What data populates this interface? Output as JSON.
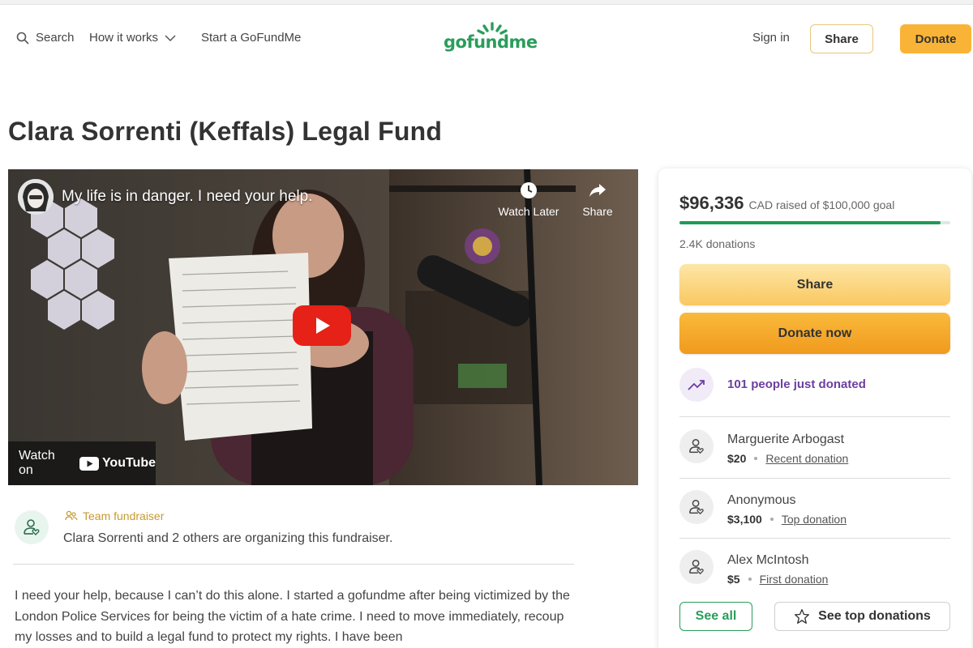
{
  "header": {
    "search_label": "Search",
    "how_label": "How it works",
    "start_label": "Start a GoFundMe",
    "logo_text": "gofundme",
    "signin_label": "Sign in",
    "share_label": "Share",
    "donate_label": "Donate"
  },
  "page": {
    "title": "Clara Sorrenti (Keffals) Legal Fund"
  },
  "video": {
    "title": "My life is in danger. I need your help.",
    "watch_later_label": "Watch Later",
    "share_label": "Share",
    "watch_on_label": "Watch on",
    "youtube_label": "YouTube"
  },
  "organizer": {
    "team_label": "Team fundraiser",
    "text": "Clara Sorrenti and 2 others are organizing this fundraiser."
  },
  "story": {
    "text": "I need your help, because I can’t do this alone. I started a gofundme after being victimized by the London Police Services for being the victim of a hate crime. I need to move immediately, recoup my losses and to build a legal fund to protect my rights. I have been"
  },
  "donation": {
    "amount": "$96,336",
    "goal_text": "CAD raised of $100,000 goal",
    "progress_fraction": 0.96336,
    "count_text": "2.4K donations",
    "share_label": "Share",
    "donate_label": "Donate now",
    "trend_text": "101 people just donated",
    "donors": [
      {
        "name": "Marguerite Arbogast",
        "amount": "$20",
        "tag": "Recent donation"
      },
      {
        "name": "Anonymous",
        "amount": "$3,100",
        "tag": "Top donation"
      },
      {
        "name": "Alex McIntosh",
        "amount": "$5",
        "tag": "First donation"
      }
    ],
    "see_all_label": "See all",
    "see_top_label": "See top donations"
  },
  "colors": {
    "brand_green": "#2a9d5c",
    "donate_orange": "#f9b437",
    "trend_purple": "#6b3fa0"
  },
  "icons": [
    "search-icon",
    "chevron-down-icon",
    "gofundme-sprout-icon",
    "clock-icon",
    "share-arrow-icon",
    "play-icon",
    "youtube-icon",
    "team-icon",
    "user-heart-icon",
    "trending-up-icon",
    "star-icon"
  ]
}
